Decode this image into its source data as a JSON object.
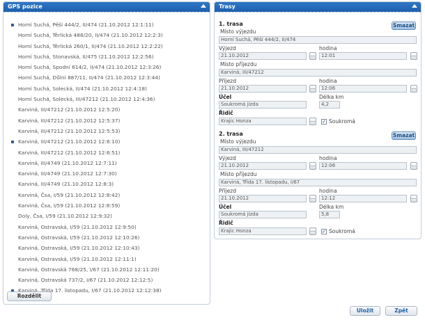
{
  "gps_panel": {
    "title": "GPS pozice",
    "items": [
      {
        "text": "Horní Suchá, Pěší 444/2, II/474 (21.10.2012 12:1:11)",
        "marked": true
      },
      {
        "text": "Horní Suchá, Těrlická 488/20, II/474 (21.10.2012 12:2:3)",
        "marked": false
      },
      {
        "text": "Horní Suchá, Těrlická 260/1, II/474 (21.10.2012 12:2:22)",
        "marked": false
      },
      {
        "text": "Horní Suchá, Stonavská, II/475 (21.10.2012 12:2:56)",
        "marked": false
      },
      {
        "text": "Horní Suchá, Spodní 614/2, II/474 (21.10.2012 12:3:26)",
        "marked": false
      },
      {
        "text": "Horní Suchá, Důlní 887/11, II/474 (21.10.2012 12:3:44)",
        "marked": false
      },
      {
        "text": "Horní Suchá, Solecká, II/474 (21.10.2012 12:4:18)",
        "marked": false
      },
      {
        "text": "Horní Suchá, Solecká, III/47212 (21.10.2012 12:4:36)",
        "marked": false
      },
      {
        "text": "Karviná, III/47212 (21.10.2012 12:5:20)",
        "marked": false
      },
      {
        "text": "Karviná, III/47212 (21.10.2012 12:5:37)",
        "marked": false
      },
      {
        "text": "Karviná, III/47212 (21.10.2012 12:5:53)",
        "marked": false
      },
      {
        "text": "Karviná, III/47212 (21.10.2012 12:6:10)",
        "marked": true
      },
      {
        "text": "Karviná, III/47212 (21.10.2012 12:6:51)",
        "marked": false
      },
      {
        "text": "Karviná, III/4749 (21.10.2012 12:7:11)",
        "marked": false
      },
      {
        "text": "Karviná, III/4749 (21.10.2012 12:7:30)",
        "marked": false
      },
      {
        "text": "Karviná, III/4749 (21.10.2012 12:8:3)",
        "marked": false
      },
      {
        "text": "Karviná, Čsa, I/59 (21.10.2012 12:8:42)",
        "marked": false
      },
      {
        "text": "Karviná, Čsa, I/59 (21.10.2012 12:8:59)",
        "marked": false
      },
      {
        "text": "Doly, Čsa, I/59 (21.10.2012 12:9:32)",
        "marked": false
      },
      {
        "text": "Karviná, Ostravská, I/59 (21.10.2012 12:9:50)",
        "marked": false
      },
      {
        "text": "Karviná, Ostravská, I/59 (21.10.2012 12:10:26)",
        "marked": false
      },
      {
        "text": "Karviná, Ostravská, I/59 (21.10.2012 12:10:43)",
        "marked": false
      },
      {
        "text": "Karviná, Ostravská, I/59 (21.10.2012 12:11:1)",
        "marked": false
      },
      {
        "text": "Karviná, Ostravská 768/25, I/67 (21.10.2012 12:11:20)",
        "marked": false
      },
      {
        "text": "Karviná, Ostravská 737/2, I/67 (21.10.2012 12:12:5)",
        "marked": false
      },
      {
        "text": "Karviná, Třída 17. listopadu, I/67 (21.10.2012 12:12:38)",
        "marked": true
      }
    ],
    "split_button": "Rozdělit"
  },
  "trasy_panel": {
    "title": "Trasy",
    "routes": [
      {
        "title": "1. trasa",
        "delete_label": "Smazat",
        "departure_place_label": "Místo výjezdu",
        "departure_place": "Horní Suchá, Pěší 444/2, II/474",
        "departure_label": "Výjezd",
        "departure_date": "21.10.2012",
        "departure_hour_label": "hodina",
        "departure_hour": "12:01",
        "arrival_place_label": "Místo příjezdu",
        "arrival_place": "Karviná, III/47212",
        "arrival_label": "Příjezd",
        "arrival_date": "21.10.2012",
        "arrival_hour_label": "hodina",
        "arrival_hour": "12:06",
        "purpose_label": "Účel",
        "purpose": "Soukromá jízda",
        "length_label": "Délka km",
        "length": "4,2",
        "driver_label": "Řidič",
        "driver": "Krajic Honza",
        "private_label": "Soukromá",
        "private_checked": true
      },
      {
        "title": "2. trasa",
        "delete_label": "Smazat",
        "departure_place_label": "Místo výjezdu",
        "departure_place": "Karviná, III/47212",
        "departure_label": "Výjezd",
        "departure_date": "21.10.2012",
        "departure_hour_label": "hodina",
        "departure_hour": "12:06",
        "arrival_place_label": "Místo příjezdu",
        "arrival_place": "Karviná, Třída 17. listopadu, I/67",
        "arrival_label": "Příjezd",
        "arrival_date": "21.10.2012",
        "arrival_hour_label": "hodina",
        "arrival_hour": "12:12",
        "purpose_label": "Účel",
        "purpose": "Soukromá jízda",
        "length_label": "Délka km",
        "length": "5,8",
        "driver_label": "Řidič",
        "driver": "Krajic Honza",
        "private_label": "Soukromá",
        "private_checked": true
      }
    ]
  },
  "footer": {
    "save_label": "Uložit",
    "back_label": "Zpět"
  },
  "icons": {
    "ellipsis": "...",
    "check": "✓"
  }
}
